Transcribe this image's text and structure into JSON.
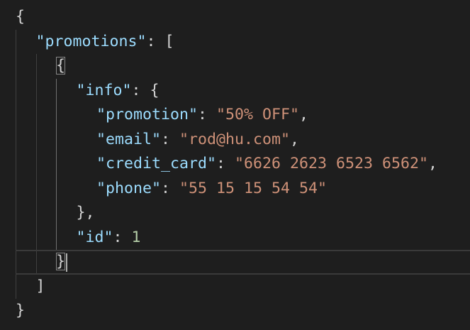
{
  "editor": {
    "lines": [
      {
        "indent": 0,
        "tokens": [
          {
            "t": "punc",
            "v": "{"
          }
        ]
      },
      {
        "indent": 1,
        "tokens": [
          {
            "t": "key",
            "v": "\"promotions\""
          },
          {
            "t": "punc",
            "v": ": ["
          }
        ]
      },
      {
        "indent": 2,
        "tokens": [
          {
            "t": "punc",
            "v": "{",
            "hl": true
          }
        ]
      },
      {
        "indent": 3,
        "tokens": [
          {
            "t": "key",
            "v": "\"info\""
          },
          {
            "t": "punc",
            "v": ": {"
          }
        ]
      },
      {
        "indent": 4,
        "tokens": [
          {
            "t": "key",
            "v": "\"promotion\""
          },
          {
            "t": "punc",
            "v": ": "
          },
          {
            "t": "str",
            "v": "\"50% OFF\""
          },
          {
            "t": "punc",
            "v": ","
          }
        ]
      },
      {
        "indent": 4,
        "tokens": [
          {
            "t": "key",
            "v": "\"email\""
          },
          {
            "t": "punc",
            "v": ": "
          },
          {
            "t": "str",
            "v": "\"rod@hu.com\""
          },
          {
            "t": "punc",
            "v": ","
          }
        ]
      },
      {
        "indent": 4,
        "tokens": [
          {
            "t": "key",
            "v": "\"credit_card\""
          },
          {
            "t": "punc",
            "v": ": "
          },
          {
            "t": "str",
            "v": "\"6626 2623 6523 6562\""
          },
          {
            "t": "punc",
            "v": ","
          }
        ]
      },
      {
        "indent": 4,
        "tokens": [
          {
            "t": "key",
            "v": "\"phone\""
          },
          {
            "t": "punc",
            "v": ": "
          },
          {
            "t": "str",
            "v": "\"55 15 15 54 54\""
          }
        ]
      },
      {
        "indent": 3,
        "tokens": [
          {
            "t": "punc",
            "v": "},"
          }
        ]
      },
      {
        "indent": 3,
        "tokens": [
          {
            "t": "key",
            "v": "\"id\""
          },
          {
            "t": "punc",
            "v": ": "
          },
          {
            "t": "num",
            "v": "1"
          }
        ]
      },
      {
        "indent": 2,
        "tokens": [
          {
            "t": "punc",
            "v": "}",
            "hl": true
          }
        ],
        "current": true
      },
      {
        "indent": 1,
        "tokens": [
          {
            "t": "punc",
            "v": "]"
          }
        ]
      },
      {
        "indent": 0,
        "tokens": [
          {
            "t": "punc",
            "v": "}"
          }
        ]
      }
    ]
  },
  "colors": {
    "background": "#1e1e1e",
    "key": "#9cdcfe",
    "string": "#ce9178",
    "number": "#b5cea8",
    "punctuation": "#d4d4d4"
  }
}
